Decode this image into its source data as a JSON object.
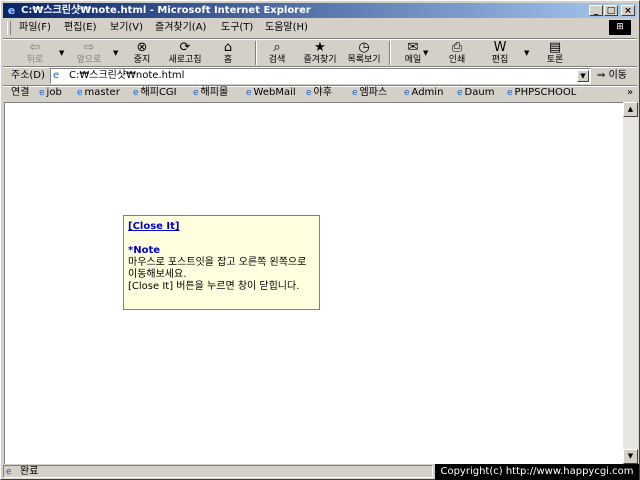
{
  "window": {
    "title": "C:₩스크린샷₩note.html - Microsoft Internet Explorer",
    "caption_buttons": {
      "minimize": "_",
      "maximize": "□",
      "close": "×"
    }
  },
  "menu": {
    "items": [
      "파일(F)",
      "편집(E)",
      "보기(V)",
      "즐겨찾기(A)",
      "도구(T)",
      "도움말(H)"
    ]
  },
  "toolbar": {
    "buttons": [
      {
        "label": "뒤로",
        "icon": "back-arrow-icon",
        "glyph": "⇦",
        "disabled": true
      },
      {
        "label": "앞으로",
        "icon": "forward-arrow-icon",
        "glyph": "⇨",
        "disabled": true
      },
      {
        "label": "중지",
        "icon": "stop-icon",
        "glyph": "⊗"
      },
      {
        "label": "새로고침",
        "icon": "refresh-icon",
        "glyph": "⟳"
      },
      {
        "label": "홈",
        "icon": "home-icon",
        "glyph": "⌂"
      },
      {
        "label": "검색",
        "icon": "search-icon",
        "glyph": "⌕"
      },
      {
        "label": "즐겨찾기",
        "icon": "favorites-icon",
        "glyph": "★"
      },
      {
        "label": "목록보기",
        "icon": "history-icon",
        "glyph": "◷"
      },
      {
        "label": "메일",
        "icon": "mail-icon",
        "glyph": "✉"
      },
      {
        "label": "인쇄",
        "icon": "print-icon",
        "glyph": "⎙"
      },
      {
        "label": "편집",
        "icon": "edit-icon",
        "glyph": "W"
      },
      {
        "label": "토론",
        "icon": "discuss-icon",
        "glyph": "▤"
      }
    ]
  },
  "address": {
    "label": "주소(D)",
    "value": "C:₩스크린샷₩note.html",
    "go_label": "이동"
  },
  "links": {
    "label": "연결",
    "items": [
      "job",
      "master",
      "해피CGI",
      "해피몰",
      "WebMail",
      "야후",
      "엠파스",
      "Admin",
      "Daum",
      "PHPSCHOOL"
    ],
    "more": "»"
  },
  "note": {
    "close_label": "[Close It]",
    "title": "*Note",
    "body_line1": "마우스로 포스트잇을 잡고 오른쪽 왼쪽으로 이동해보세요.",
    "body_line2": "[Close It] 버튼을 누르면 창이 닫힙니다."
  },
  "status": {
    "text": "완료",
    "copyright": "Copyright(c) http://www.happycgi.com"
  }
}
